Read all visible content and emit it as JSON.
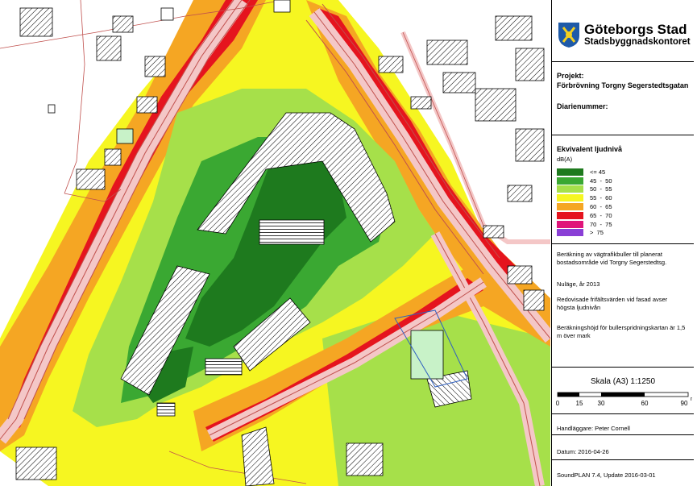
{
  "header": {
    "org_name": "Göteborgs Stad",
    "org_department": "Stadsbyggnadskontoret"
  },
  "project": {
    "label": "Projekt:",
    "name": "Förbrövning Torgny Segerstedtsgatan",
    "diary_label": "Diarienummer:"
  },
  "legend": {
    "title": "Ekvivalent ljudnivå",
    "unit": "dB(A)",
    "items": [
      {
        "label": "<= 45",
        "color": "#1e7a1e"
      },
      {
        "label": "45  -  50",
        "color": "#3aa832"
      },
      {
        "label": "50  -  55",
        "color": "#a6e04a"
      },
      {
        "label": "55  -  60",
        "color": "#f6f621"
      },
      {
        "label": "60  -  65",
        "color": "#f5a623"
      },
      {
        "label": "65  -  70",
        "color": "#e5141e"
      },
      {
        "label": "70  -  75",
        "color": "#e0157a"
      },
      {
        "label": ">  75",
        "color": "#8a3fd6"
      }
    ]
  },
  "description": {
    "p1": "Beräkning av vägtrafikbuller till planerat bostadsområde vid Torgny Segerstedtsg.",
    "p2": "Nuläge, år 2013",
    "p3": "Redovisade frifältsvärden vid fasad avser högsta ljudnivån",
    "p4": "Beräkningshöjd för bullerspridningskartan är 1,5 m över mark"
  },
  "scale": {
    "title": "Skala (A3) 1:1250",
    "ticks": [
      "0",
      "15",
      "30",
      "60",
      "90"
    ],
    "unit": "m"
  },
  "footer": {
    "handler": "Handläggare: Peter Cornell",
    "date": "Datum: 2016-04-26",
    "software": "SoundPLAN 7.4, Update 2016-03-01"
  }
}
